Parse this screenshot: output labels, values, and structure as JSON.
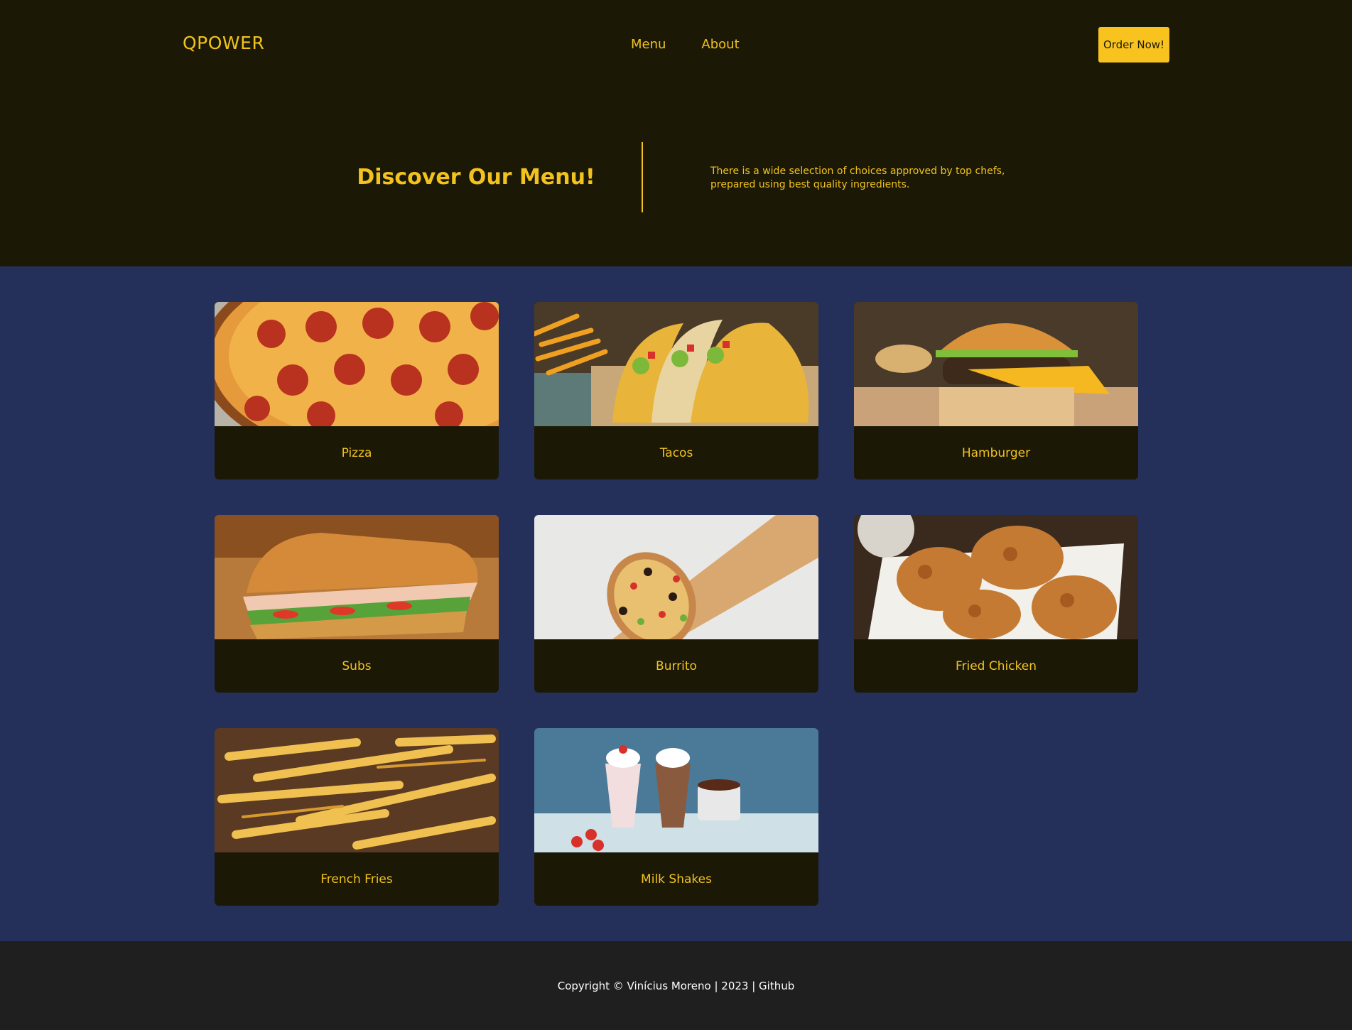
{
  "header": {
    "logo": "QPOWER",
    "nav": [
      "Menu",
      "About"
    ],
    "order_button": "Order Now!"
  },
  "hero": {
    "title": "Discover Our Menu!",
    "description": "There is a wide selection of choices approved by top chefs, prepared using best quality ingredients."
  },
  "menu": {
    "items": [
      {
        "label": "Pizza",
        "icon": "pizza-image"
      },
      {
        "label": "Tacos",
        "icon": "tacos-image"
      },
      {
        "label": "Hamburger",
        "icon": "hamburger-image"
      },
      {
        "label": "Subs",
        "icon": "subs-image"
      },
      {
        "label": "Burrito",
        "icon": "burrito-image"
      },
      {
        "label": "Fried Chicken",
        "icon": "fried-chicken-image"
      },
      {
        "label": "French Fries",
        "icon": "french-fries-image"
      },
      {
        "label": "Milk Shakes",
        "icon": "milk-shakes-image"
      }
    ]
  },
  "footer": {
    "text": "Copyright © Vinícius Moreno | 2023 | Github"
  },
  "colors": {
    "header_bg": "#1b1906",
    "accent": "#f2c21e",
    "button_bg": "#f9c31f",
    "grid_bg": "#24305a",
    "footer_bg": "#1f1f1f"
  }
}
